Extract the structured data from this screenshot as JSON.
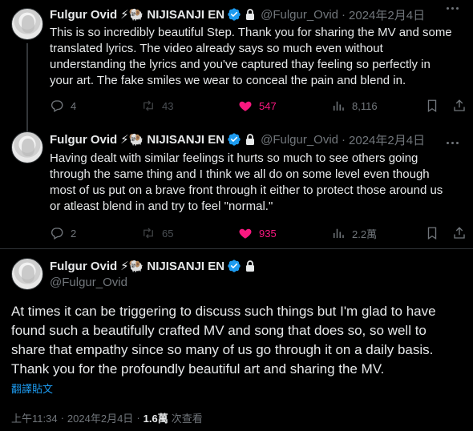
{
  "tweets": [
    {
      "name": "Fulgur Ovid",
      "emoji": "⚡🐏",
      "org": "NIJISANJI EN",
      "handle": "@Fulgur_Ovid",
      "date": "2024年2月4日",
      "lines": [
        "This is so incredibly beautiful Step. Thank you for sharing the MV and some",
        "translated lyrics. The video already says so much even without",
        "understanding the lyrics and you've captured thay feeling so perfectly in",
        "your art. The fake smiles we wear to conceal the pain and blend in."
      ],
      "replies": "4",
      "retweets": "43",
      "likes": "547",
      "views": "8,116"
    },
    {
      "name": "Fulgur Ovid",
      "emoji": "⚡🐏",
      "org": "NIJISANJI EN",
      "handle": "@Fulgur_Ovid",
      "date": "2024年2月4日",
      "lines": [
        "Having dealt with similar feelings it hurts so much to see others going",
        "through the same thing and I think we all do on some level even though",
        "most of us put on a brave front through it either to protect those around us",
        "or atleast blend in and try to feel \"normal.\""
      ],
      "replies": "2",
      "retweets": "65",
      "likes": "935",
      "views": "2.2萬"
    }
  ],
  "main": {
    "name": "Fulgur Ovid",
    "emoji": "⚡🐏",
    "org": "NIJISANJI EN",
    "handle": "@Fulgur_Ovid",
    "lines": [
      "At times it can be triggering to discuss such things but I'm glad to have",
      "found such a beautifully crafted MV and song that does so, so well to",
      "share that empathy since so many of us go through it on a daily basis.",
      "Thank you for the profoundly beautiful art and sharing the MV."
    ],
    "translate_label": "翻譯貼文",
    "time": "上午11:34",
    "date": "2024年2月4日",
    "views_count": "1.6萬",
    "views_label": "次查看"
  },
  "separator": "·",
  "colors": {
    "background": "#000000",
    "text": "#e7e9ea",
    "muted": "#71767b",
    "like": "#f91880",
    "link": "#1d9bf0",
    "verified": "#1d9bf0"
  }
}
